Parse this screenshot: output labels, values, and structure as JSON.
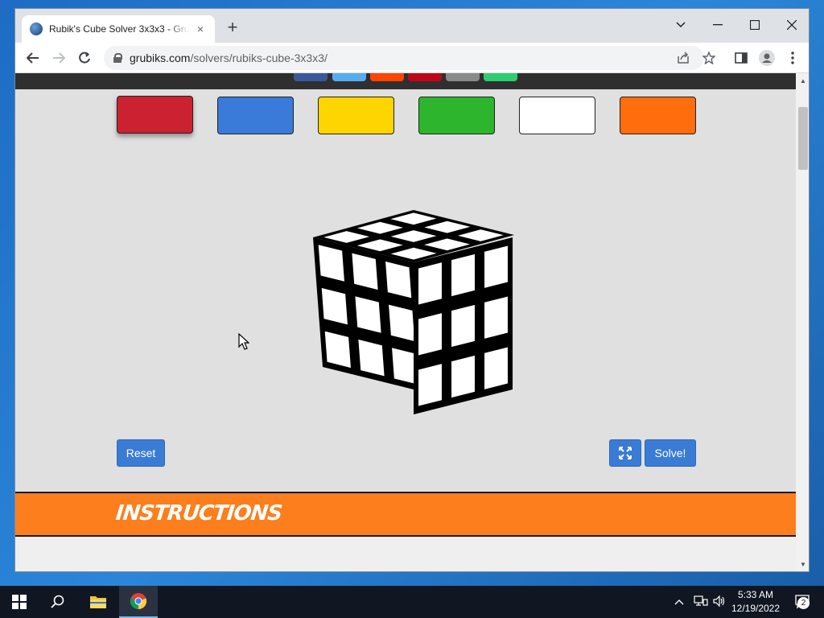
{
  "browser": {
    "tab_title": "Rubik's Cube Solver 3x3x3 - Grubiks",
    "tab_close": "×",
    "new_tab": "+",
    "url_domain": "grubiks.com",
    "url_path": "/solvers/rubiks-cube-3x3x3/"
  },
  "colors": {
    "palette": [
      {
        "name": "red",
        "hex": "#cc2130"
      },
      {
        "name": "blue",
        "hex": "#3a7ad9"
      },
      {
        "name": "yellow",
        "hex": "#ffd500"
      },
      {
        "name": "green",
        "hex": "#2db52d"
      },
      {
        "name": "white",
        "hex": "#ffffff"
      },
      {
        "name": "orange",
        "hex": "#ff6d0c"
      }
    ],
    "selected": "red",
    "share_buttons": [
      "#3b5998",
      "#55acee",
      "#ff4500",
      "#bd081c",
      "#8a8a8a",
      "#2ecc71"
    ],
    "accent": "#3a7bd5",
    "instructions_bg": "#fd7e1c"
  },
  "cube": {
    "faces": [
      "top",
      "left",
      "right"
    ],
    "sticker_color": "#ffffff",
    "grid": "3x3"
  },
  "controls": {
    "reset_label": "Reset",
    "solve_label": "Solve!",
    "fullscreen_icon": "expand-icon"
  },
  "section": {
    "instructions_title": "INSTRUCTIONS"
  },
  "taskbar": {
    "time": "5:33 AM",
    "date": "12/19/2022",
    "notification_count": "2"
  }
}
